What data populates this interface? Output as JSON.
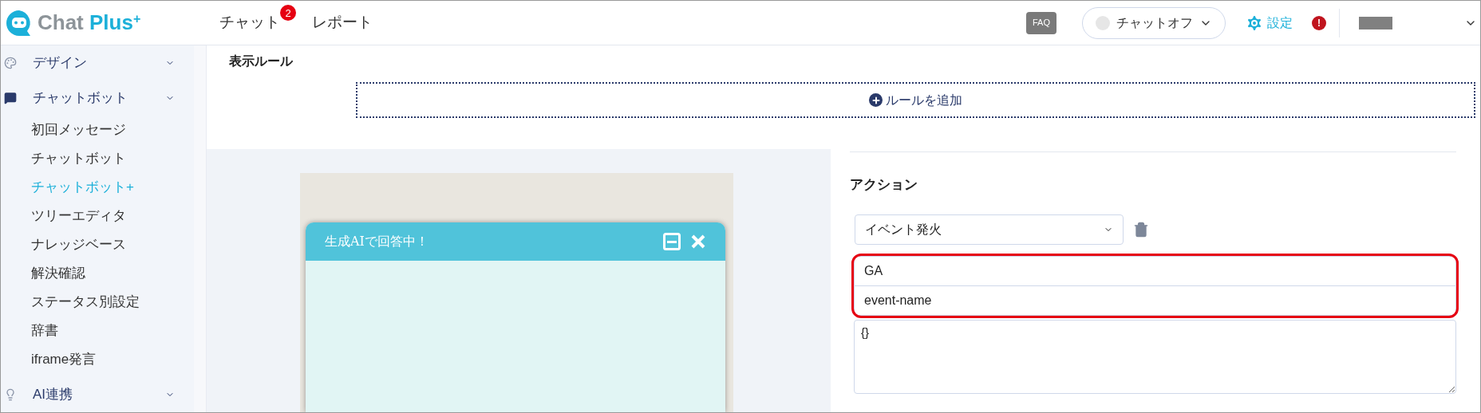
{
  "header": {
    "logo": {
      "text": "Chat",
      "accent": "Plus",
      "mark": "+"
    },
    "nav": [
      {
        "label": "チャット",
        "badge": "2"
      },
      {
        "label": "レポート"
      }
    ],
    "faq": "FAQ",
    "chat_toggle": {
      "label": "チャットオフ",
      "on": false
    },
    "settings": "設定",
    "alert": "!"
  },
  "sidebar": {
    "groups": [
      {
        "label": "デザイン"
      },
      {
        "label": "チャットボット",
        "children": [
          {
            "label": "初回メッセージ",
            "selected": false
          },
          {
            "label": "チャットボット",
            "selected": false
          },
          {
            "label": "チャットボット+",
            "selected": true
          },
          {
            "label": "ツリーエディタ",
            "selected": false
          },
          {
            "label": "ナレッジベース",
            "selected": false
          },
          {
            "label": "解決確認",
            "selected": false
          },
          {
            "label": "ステータス別設定",
            "selected": false
          },
          {
            "label": "辞書",
            "selected": false
          },
          {
            "label": "iframe発言",
            "selected": false
          }
        ]
      },
      {
        "label": "AI連携"
      }
    ]
  },
  "display_rules": {
    "title": "表示ルール",
    "add_button": "ルールを追加"
  },
  "preview": {
    "widget_title": "生成AIで回答中！"
  },
  "action": {
    "title": "アクション",
    "select": "イベント発火",
    "fields": {
      "highlighted": true,
      "category": "GA",
      "event": "event-name",
      "params": "{}"
    }
  }
}
